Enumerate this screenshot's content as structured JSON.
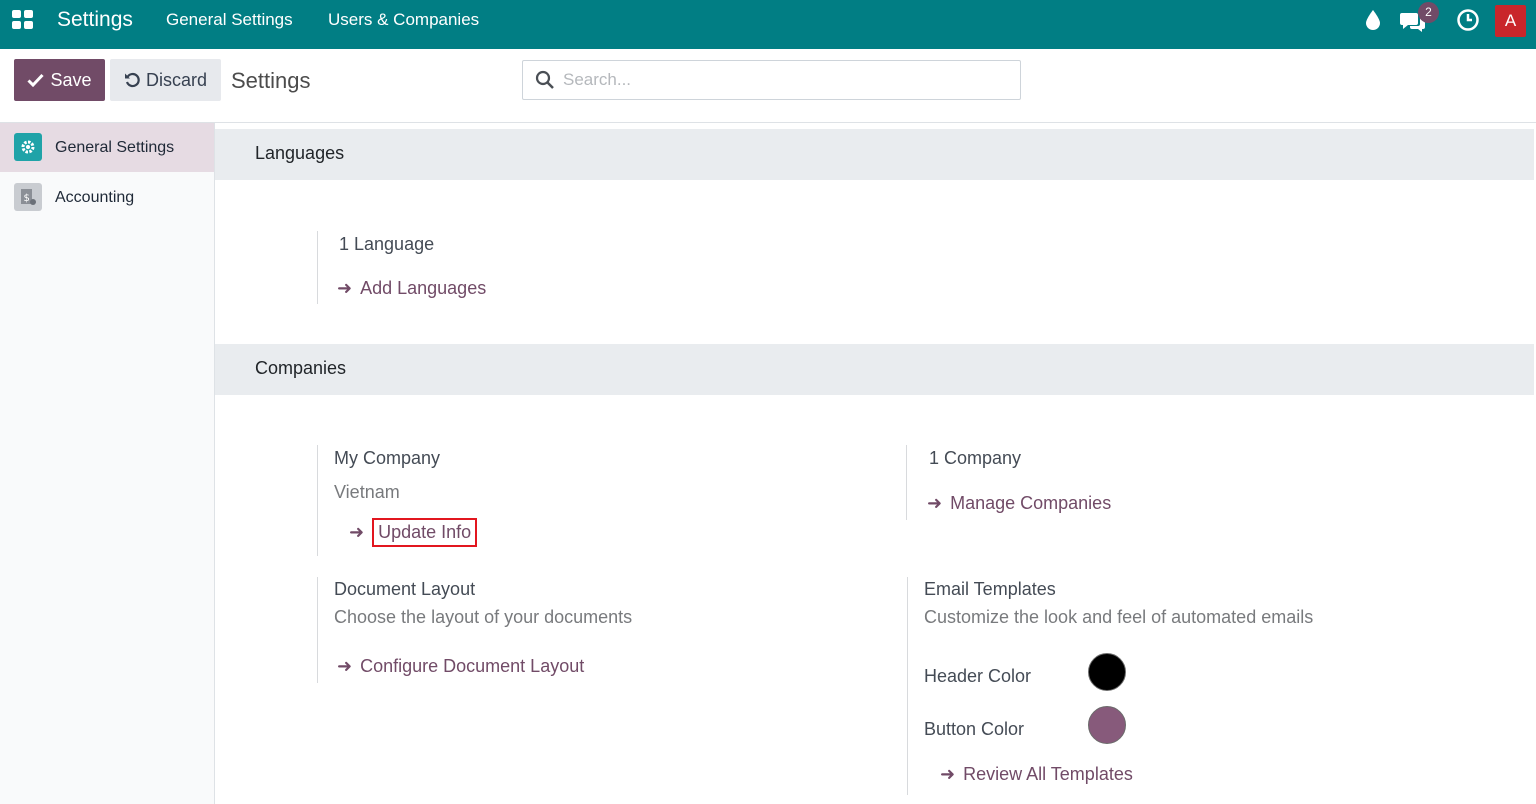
{
  "navbar": {
    "brand": "Settings",
    "menu": [
      {
        "label": "General Settings"
      },
      {
        "label": "Users & Companies"
      }
    ],
    "messages_badge": "2",
    "avatar_letter": "A"
  },
  "control_panel": {
    "save_label": "Save",
    "discard_label": "Discard",
    "title": "Settings",
    "search_placeholder": "Search..."
  },
  "sidebar": {
    "items": [
      {
        "label": "General Settings",
        "icon": "gear-icon",
        "active": true
      },
      {
        "label": "Accounting",
        "icon": "accounting-icon",
        "active": false
      }
    ]
  },
  "languages": {
    "header": "Languages",
    "count_text": "1 Language",
    "link": "Add Languages"
  },
  "companies": {
    "header": "Companies",
    "company_name": "My Company",
    "company_country": "Vietnam",
    "update_link": "Update Info",
    "company_count": "1 Company",
    "manage_link": "Manage Companies",
    "doc_layout_title": "Document Layout",
    "doc_layout_desc": "Choose the layout of your documents",
    "doc_layout_link": "Configure Document Layout",
    "email_title": "Email Templates",
    "email_desc": "Customize the look and feel of automated emails",
    "header_color_label": "Header Color",
    "header_color": "#000000",
    "button_color_label": "Button Color",
    "button_color": "#875a7b",
    "review_link": "Review All Templates"
  },
  "colors": {
    "navbar": "#017e84",
    "primary": "#714b67",
    "highlight_border": "#e2161f"
  }
}
